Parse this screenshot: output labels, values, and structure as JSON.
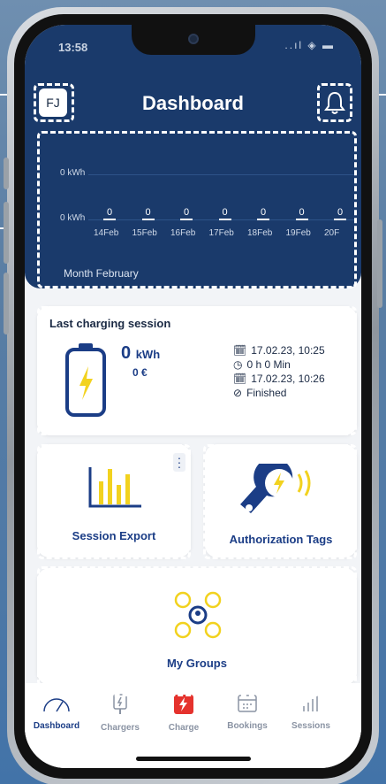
{
  "status": {
    "time": "13:58",
    "icons": "..ıl ◈ ▬"
  },
  "header": {
    "avatar": "FJ",
    "title": "Dashboard"
  },
  "chart_data": {
    "type": "bar",
    "categories": [
      "14Feb",
      "15Feb",
      "16Feb",
      "17Feb",
      "18Feb",
      "19Feb",
      "20F"
    ],
    "values": [
      0,
      0,
      0,
      0,
      0,
      0,
      0
    ],
    "value_labels": [
      "0",
      "0",
      "0",
      "0",
      "0",
      "0",
      "0"
    ],
    "y_ticks": [
      "0 kWh",
      "0 kWh"
    ],
    "footer": "Month February"
  },
  "session": {
    "title": "Last charging session",
    "kwh_value": "0",
    "kwh_unit": "kWh",
    "cost": "0 €",
    "start": "17.02.23, 10:25",
    "duration": "0 h 0 Min",
    "end": "17.02.23, 10:26",
    "status": "Finished"
  },
  "tiles": {
    "export": "Session Export",
    "auth": "Authorization Tags",
    "groups": "My Groups"
  },
  "tabs": [
    {
      "label": "Dashboard",
      "icon": "gauge-icon"
    },
    {
      "label": "Chargers",
      "icon": "charger-icon"
    },
    {
      "label": "Charge",
      "icon": "charge-icon"
    },
    {
      "label": "Bookings",
      "icon": "calendar-icon"
    },
    {
      "label": "Sessions",
      "icon": "bar-chart-icon"
    }
  ],
  "colors": {
    "primary": "#1a3a6b",
    "accent": "#f2d21f",
    "active_tab": "#1b3d86",
    "charge_red": "#e5322d"
  }
}
